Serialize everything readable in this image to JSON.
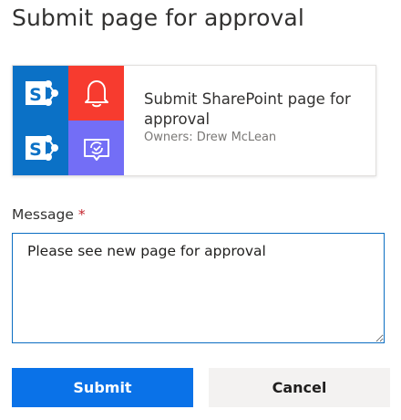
{
  "dialog": {
    "title": "Submit page for approval"
  },
  "flow_card": {
    "title": "Submit SharePoint page for approval",
    "owners": "Owners: Drew McLean",
    "tiles": [
      {
        "icon": "sharepoint-icon",
        "color": "#0b71c6"
      },
      {
        "icon": "bell-notification-icon",
        "color": "#f73b2f"
      },
      {
        "icon": "sharepoint-icon",
        "color": "#0b71c6"
      },
      {
        "icon": "approval-icon",
        "color": "#736ef6"
      }
    ]
  },
  "message_field": {
    "label": "Message",
    "required_marker": "*",
    "value": "Please see new page for approval"
  },
  "actions": {
    "submit_label": "Submit",
    "cancel_label": "Cancel"
  },
  "colors": {
    "primary": "#0a72e8",
    "focus_border": "#0b6ec2",
    "required": "#c4262e"
  }
}
